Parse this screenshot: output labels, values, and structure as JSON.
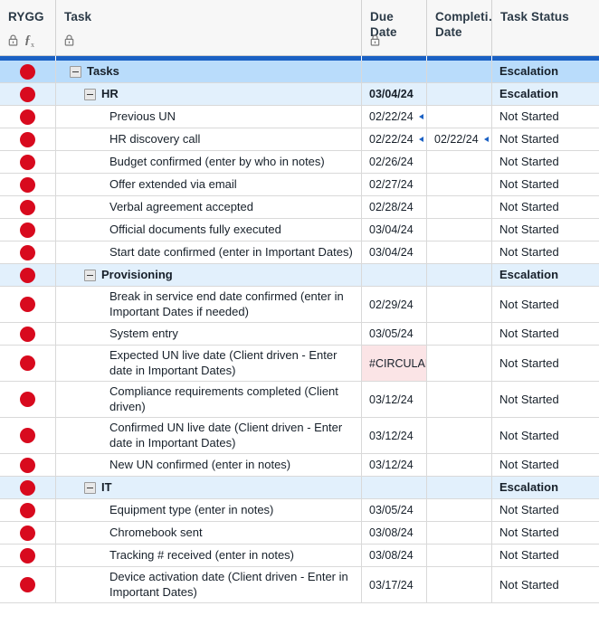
{
  "header": {
    "columns": [
      {
        "id": "rygg",
        "title": "RYGG",
        "icons": [
          "lock-icon",
          "formula-icon"
        ]
      },
      {
        "id": "task",
        "title": "Task",
        "icons": [
          "lock-icon"
        ]
      },
      {
        "id": "due",
        "title": "Due Date",
        "icons": [
          "lock-icon"
        ]
      },
      {
        "id": "comp",
        "title": "Completi…\nDate",
        "icons": []
      },
      {
        "id": "status",
        "title": "Task Status",
        "icons": []
      }
    ]
  },
  "colors": {
    "accent_blue": "#1b61c4",
    "group_row_level0": "#b9dcfb",
    "group_row_level1": "#e2f0fc",
    "indicator_red": "#d80a1e",
    "error_cell_bg": "#fbe4e6",
    "header_bg": "#f7f7f7",
    "grid_line": "#d9d9d9"
  },
  "rows": [
    {
      "rygg": "red-dot",
      "level": 0,
      "collapsible": true,
      "task": "Tasks",
      "due": "",
      "due_marker": false,
      "completion": "",
      "completion_marker": false,
      "status": "Escalation",
      "due_error": false
    },
    {
      "rygg": "red-dot",
      "level": 1,
      "collapsible": true,
      "task": "HR",
      "due": "03/04/24",
      "due_marker": false,
      "completion": "",
      "completion_marker": false,
      "status": "Escalation",
      "due_error": false
    },
    {
      "rygg": "red-dot",
      "level": 2,
      "collapsible": false,
      "task": "Previous UN",
      "due": "02/22/24",
      "due_marker": true,
      "completion": "",
      "completion_marker": false,
      "status": "Not Started",
      "due_error": false
    },
    {
      "rygg": "red-dot",
      "level": 2,
      "collapsible": false,
      "task": "HR discovery call",
      "due": "02/22/24",
      "due_marker": true,
      "completion": "02/22/24",
      "completion_marker": true,
      "status": "Not Started",
      "due_error": false
    },
    {
      "rygg": "red-dot",
      "level": 2,
      "collapsible": false,
      "task": "Budget confirmed (enter by who in notes)",
      "due": "02/26/24",
      "due_marker": false,
      "completion": "",
      "completion_marker": false,
      "status": "Not Started",
      "due_error": false
    },
    {
      "rygg": "red-dot",
      "level": 2,
      "collapsible": false,
      "task": "Offer extended via email",
      "due": "02/27/24",
      "due_marker": false,
      "completion": "",
      "completion_marker": false,
      "status": "Not Started",
      "due_error": false
    },
    {
      "rygg": "red-dot",
      "level": 2,
      "collapsible": false,
      "task": "Verbal agreement accepted",
      "due": "02/28/24",
      "due_marker": false,
      "completion": "",
      "completion_marker": false,
      "status": "Not Started",
      "due_error": false
    },
    {
      "rygg": "red-dot",
      "level": 2,
      "collapsible": false,
      "task": "Official documents fully executed",
      "due": "03/04/24",
      "due_marker": false,
      "completion": "",
      "completion_marker": false,
      "status": "Not Started",
      "due_error": false
    },
    {
      "rygg": "red-dot",
      "level": 2,
      "collapsible": false,
      "task": "Start date confirmed (enter in Important Dates)",
      "due": "03/04/24",
      "due_marker": false,
      "completion": "",
      "completion_marker": false,
      "status": "Not Started",
      "due_error": false
    },
    {
      "rygg": "red-dot",
      "level": 1,
      "collapsible": true,
      "task": "Provisioning",
      "due": "",
      "due_marker": false,
      "completion": "",
      "completion_marker": false,
      "status": "Escalation",
      "due_error": false
    },
    {
      "rygg": "red-dot",
      "level": 2,
      "collapsible": false,
      "task": "Break in service end date confirmed (enter in Important Dates if needed)",
      "due": "02/29/24",
      "due_marker": false,
      "completion": "",
      "completion_marker": false,
      "status": "Not Started",
      "due_error": false
    },
    {
      "rygg": "red-dot",
      "level": 2,
      "collapsible": false,
      "task": "System entry",
      "due": "03/05/24",
      "due_marker": false,
      "completion": "",
      "completion_marker": false,
      "status": "Not Started",
      "due_error": false
    },
    {
      "rygg": "red-dot",
      "level": 2,
      "collapsible": false,
      "task": "Expected UN live date (Client driven - Enter date in Important Dates)",
      "due": "#CIRCULAR",
      "due_marker": false,
      "completion": "",
      "completion_marker": false,
      "status": "Not Started",
      "due_error": true
    },
    {
      "rygg": "red-dot",
      "level": 2,
      "collapsible": false,
      "task": "Compliance requirements completed (Client driven)",
      "due": "03/12/24",
      "due_marker": false,
      "completion": "",
      "completion_marker": false,
      "status": "Not Started",
      "due_error": false
    },
    {
      "rygg": "red-dot",
      "level": 2,
      "collapsible": false,
      "task": "Confirmed UN live date (Client driven - Enter date in Important Dates)",
      "due": "03/12/24",
      "due_marker": false,
      "completion": "",
      "completion_marker": false,
      "status": "Not Started",
      "due_error": false
    },
    {
      "rygg": "red-dot",
      "level": 2,
      "collapsible": false,
      "task": "New UN confirmed (enter in notes)",
      "due": "03/12/24",
      "due_marker": false,
      "completion": "",
      "completion_marker": false,
      "status": "Not Started",
      "due_error": false
    },
    {
      "rygg": "red-dot",
      "level": 1,
      "collapsible": true,
      "task": "IT",
      "due": "",
      "due_marker": false,
      "completion": "",
      "completion_marker": false,
      "status": "Escalation",
      "due_error": false
    },
    {
      "rygg": "red-dot",
      "level": 2,
      "collapsible": false,
      "task": "Equipment type (enter in notes)",
      "due": "03/05/24",
      "due_marker": false,
      "completion": "",
      "completion_marker": false,
      "status": "Not Started",
      "due_error": false
    },
    {
      "rygg": "red-dot",
      "level": 2,
      "collapsible": false,
      "task": "Chromebook sent",
      "due": "03/08/24",
      "due_marker": false,
      "completion": "",
      "completion_marker": false,
      "status": "Not Started",
      "due_error": false
    },
    {
      "rygg": "red-dot",
      "level": 2,
      "collapsible": false,
      "task": "Tracking # received (enter in notes)",
      "due": "03/08/24",
      "due_marker": false,
      "completion": "",
      "completion_marker": false,
      "status": "Not Started",
      "due_error": false
    },
    {
      "rygg": "red-dot",
      "level": 2,
      "collapsible": false,
      "task": "Device activation date (Client driven - Enter in Important Dates)",
      "due": "03/17/24",
      "due_marker": false,
      "completion": "",
      "completion_marker": false,
      "status": "Not Started",
      "due_error": false
    }
  ]
}
